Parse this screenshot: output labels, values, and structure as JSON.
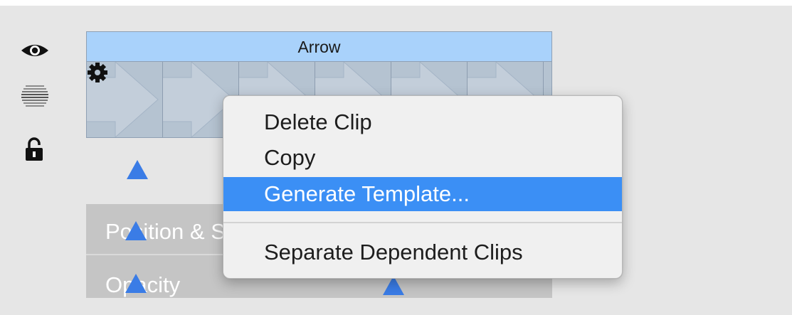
{
  "track_controls": {
    "icons": [
      "eye-icon",
      "waveform-icon",
      "lock-open-icon"
    ]
  },
  "clip": {
    "title": "Arrow",
    "header_color": "#a9d2fb",
    "frames": 6,
    "gear_icon": "gear-icon"
  },
  "properties": {
    "rows": [
      {
        "label": "Position & Scale"
      },
      {
        "label": "Opacity"
      }
    ]
  },
  "context_menu": {
    "items": [
      {
        "label": "Delete Clip"
      },
      {
        "label": "Copy"
      },
      {
        "label": "Generate Template..."
      },
      {
        "label": "Separate Dependent Clips"
      }
    ],
    "highlighted": "Generate Template...",
    "highlight_color": "#3b8ff5"
  },
  "keyframe_color": "#3a7ce6"
}
